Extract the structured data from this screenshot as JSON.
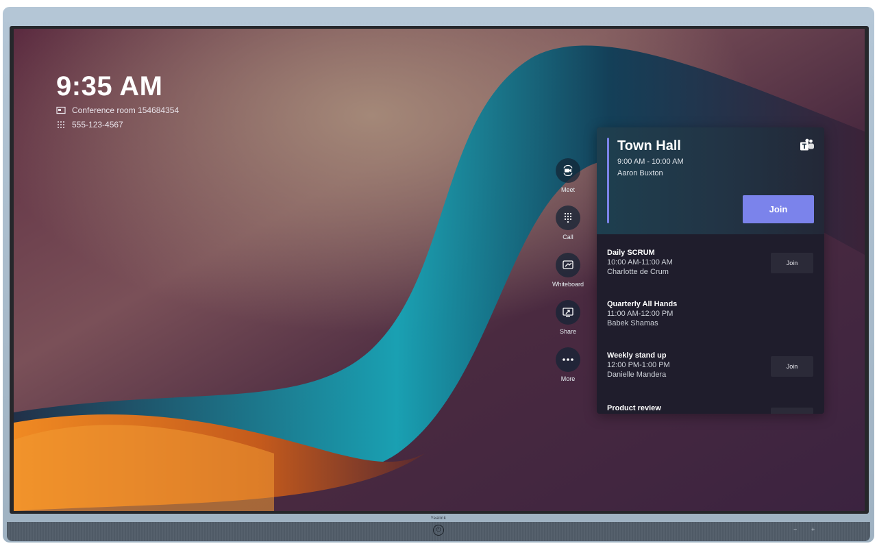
{
  "device": {
    "brand": "Yealink"
  },
  "home": {
    "clock": "9:35 AM",
    "room_name": "Conference room 154684354",
    "phone_number": "555-123-4567"
  },
  "actions": [
    {
      "label": "Meet",
      "icon": "camera-icon"
    },
    {
      "label": "Call",
      "icon": "dialpad-icon"
    },
    {
      "label": "Whiteboard",
      "icon": "whiteboard-icon"
    },
    {
      "label": "Share",
      "icon": "share-screen-icon"
    },
    {
      "label": "More",
      "icon": "more-icon"
    }
  ],
  "featured_meeting": {
    "title": "Town Hall",
    "time": "9:00 AM - 10:00 AM",
    "organizer": "Aaron Buxton",
    "join_label": "Join",
    "app_icon": "teams-icon",
    "accent_color": "#7b83eb"
  },
  "meetings": [
    {
      "title": "Daily SCRUM",
      "time": "10:00 AM-11:00 AM",
      "organizer": "Charlotte de Crum",
      "join_label": "Join"
    },
    {
      "title": "Quarterly All Hands",
      "time": "11:00 AM-12:00 PM",
      "organizer": "Babek Shamas",
      "join_label": ""
    },
    {
      "title": "Weekly stand up",
      "time": "12:00 PM-1:00 PM",
      "organizer": "Danielle Mandera",
      "join_label": "Join"
    },
    {
      "title": "Product review",
      "time": "",
      "organizer": "",
      "join_label": ""
    }
  ]
}
